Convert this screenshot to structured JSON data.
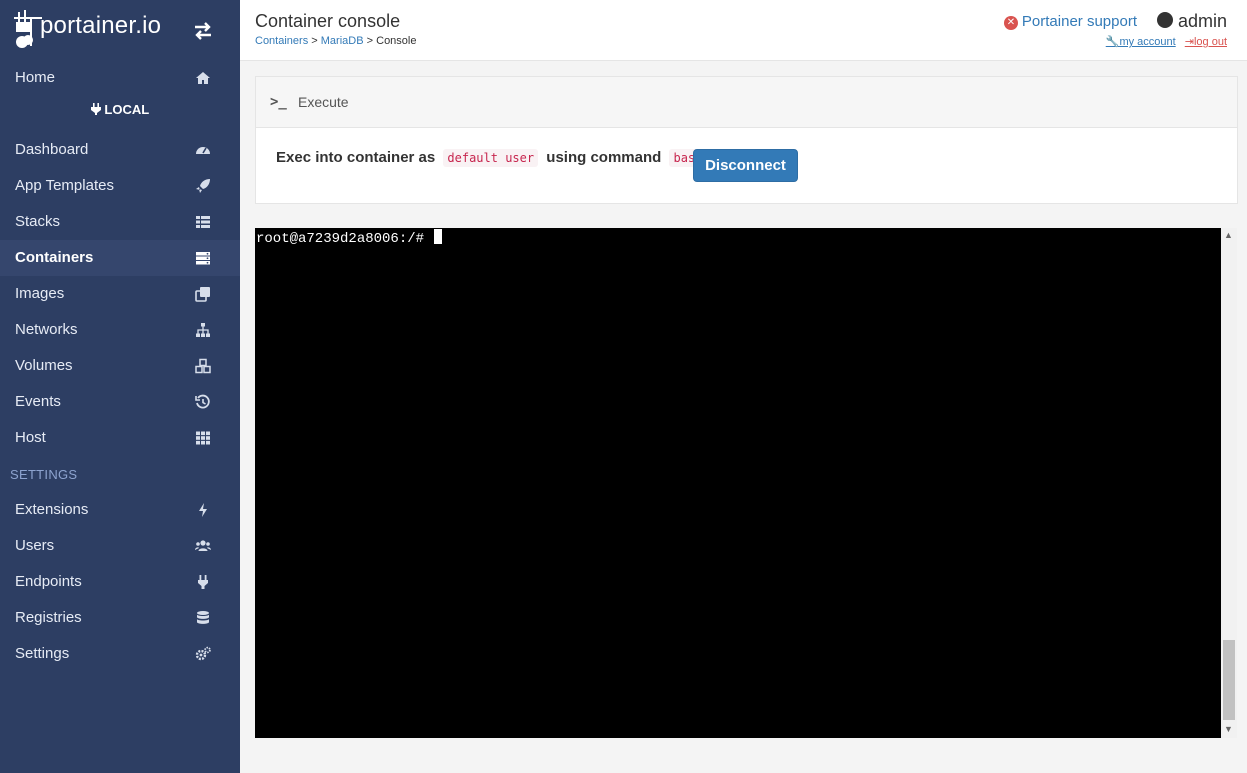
{
  "brand": {
    "name": "portainer.io"
  },
  "sidebar": {
    "endpoint_label": "LOCAL",
    "settings_header": "SETTINGS",
    "items": [
      {
        "label": "Home",
        "icon": "home-icon"
      },
      {
        "label": "Dashboard",
        "icon": "tachometer-icon"
      },
      {
        "label": "App Templates",
        "icon": "rocket-icon"
      },
      {
        "label": "Stacks",
        "icon": "th-list-icon"
      },
      {
        "label": "Containers",
        "icon": "server-icon",
        "active": true
      },
      {
        "label": "Images",
        "icon": "clone-icon"
      },
      {
        "label": "Networks",
        "icon": "sitemap-icon"
      },
      {
        "label": "Volumes",
        "icon": "cubes-icon"
      },
      {
        "label": "Events",
        "icon": "history-icon"
      },
      {
        "label": "Host",
        "icon": "th-icon"
      },
      {
        "label": "Extensions",
        "icon": "bolt-icon"
      },
      {
        "label": "Users",
        "icon": "users-icon"
      },
      {
        "label": "Endpoints",
        "icon": "plug-icon"
      },
      {
        "label": "Registries",
        "icon": "database-icon"
      },
      {
        "label": "Settings",
        "icon": "cogs-icon"
      }
    ]
  },
  "header": {
    "title": "Container console",
    "breadcrumb": {
      "containers": "Containers",
      "sep1": ">",
      "container": "MariaDB",
      "sep2": ">",
      "current": "Console"
    },
    "support_label": "Portainer support",
    "username": "admin",
    "my_account": "my account",
    "log_out": "log out"
  },
  "execute": {
    "title": "Execute",
    "prefix": "Exec into container as",
    "user": "default user",
    "middle": "using command",
    "command": "bash",
    "disconnect_label": "Disconnect"
  },
  "terminal": {
    "prompt": "root@a7239d2a8006:/#"
  },
  "colors": {
    "sidebar_bg": "#2d3e63",
    "primary": "#337ab7",
    "danger": "#d9534f",
    "terminal_bg": "#000000"
  }
}
